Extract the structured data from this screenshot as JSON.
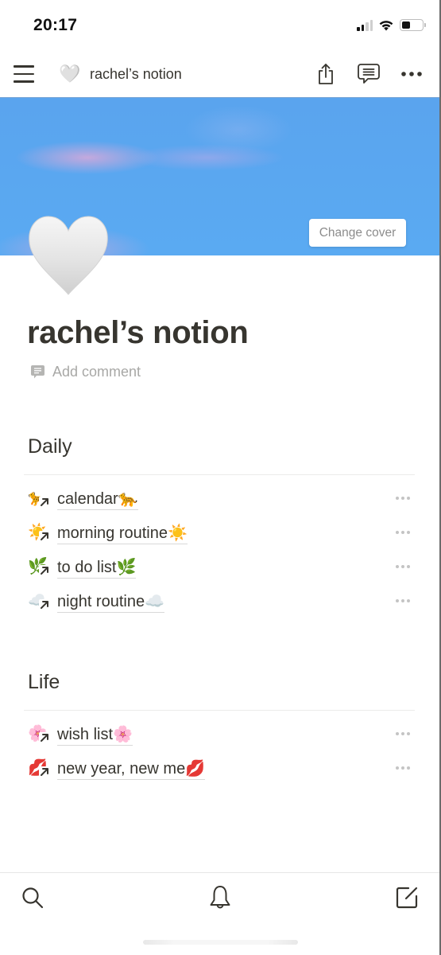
{
  "status_bar": {
    "time": "20:17",
    "signal_bars_active": 2,
    "signal_bars_total": 4,
    "battery_level": 0.4
  },
  "nav_bar": {
    "menu_icon": "hamburger-menu-icon",
    "page_icon": "🤍",
    "page_title": "rachel’s notion",
    "actions": [
      "share-icon",
      "comments-icon",
      "more-icon"
    ]
  },
  "cover": {
    "change_cover_label": "Change cover",
    "colors": {
      "sky": "#5aa7f0",
      "cloud": "#e4aadb"
    }
  },
  "page": {
    "icon": "🤍",
    "title": "rachel’s notion",
    "add_comment_label": "Add comment"
  },
  "sections": [
    {
      "heading": "Daily",
      "links": [
        {
          "emoji": "🐆",
          "label": "calendar🐆"
        },
        {
          "emoji": "☀️",
          "label": "morning routine☀️"
        },
        {
          "emoji": "🌿",
          "label": "to do list🌿"
        },
        {
          "emoji": "☁️",
          "label": "night routine☁️"
        }
      ]
    },
    {
      "heading": "Life",
      "links": [
        {
          "emoji": "🌸",
          "label": "wish list🌸"
        },
        {
          "emoji": "💋",
          "label": "new year, new me💋"
        }
      ]
    }
  ],
  "bottom_bar": {
    "items": [
      "search-icon",
      "bell-icon",
      "compose-icon"
    ]
  },
  "colors": {
    "text": "#37352f",
    "muted": "#a8a8a6",
    "divider": "#ebebea"
  }
}
